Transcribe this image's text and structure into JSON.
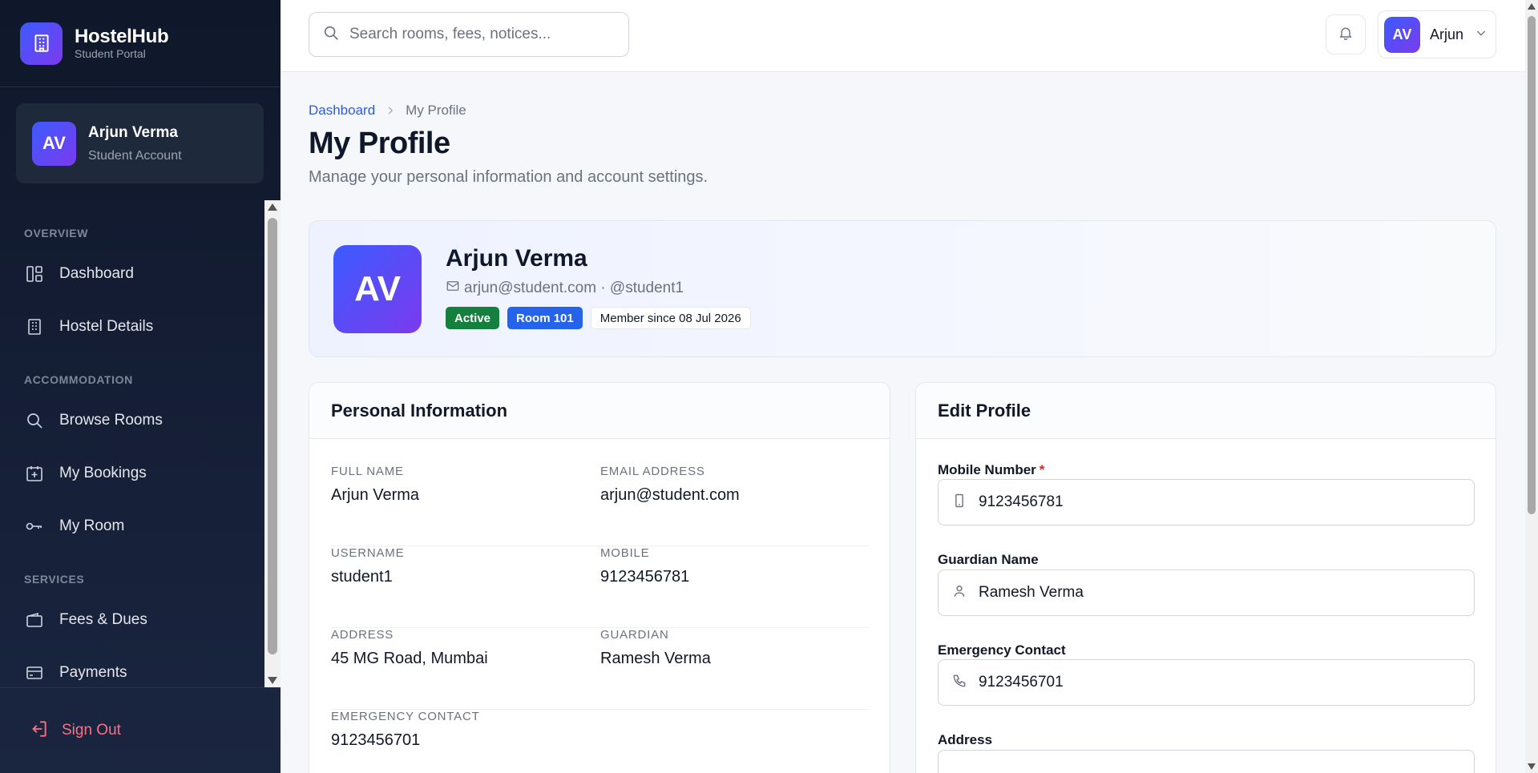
{
  "brand": {
    "title": "HostelHub",
    "subtitle": "Student Portal"
  },
  "user_card": {
    "initials": "AV",
    "name": "Arjun Verma",
    "role": "Student Account"
  },
  "nav": {
    "sections": [
      "OVERVIEW",
      "ACCOMMODATION",
      "SERVICES"
    ],
    "items": [
      {
        "label": "Dashboard",
        "icon": "dashboard-icon"
      },
      {
        "label": "Hostel Details",
        "icon": "building-icon"
      },
      {
        "label": "Browse Rooms",
        "icon": "search-icon"
      },
      {
        "label": "My Bookings",
        "icon": "calendar-plus-icon"
      },
      {
        "label": "My Room",
        "icon": "key-icon"
      },
      {
        "label": "Fees & Dues",
        "icon": "wallet-icon"
      },
      {
        "label": "Payments",
        "icon": "credit-card-icon"
      }
    ],
    "signout": "Sign Out"
  },
  "topbar": {
    "search_placeholder": "Search rooms, fees, notices...",
    "user_initials": "AV",
    "user_name": "Arjun"
  },
  "breadcrumb": {
    "home": "Dashboard",
    "current": "My Profile"
  },
  "page": {
    "title": "My Profile",
    "subtitle": "Manage your personal information and account settings."
  },
  "hero": {
    "initials": "AV",
    "name": "Arjun Verma",
    "email_line": "arjun@student.com · @student1",
    "badges": {
      "status": "Active",
      "room": "Room 101",
      "since": "Member since 08 Jul 2026"
    }
  },
  "personal_info": {
    "title": "Personal Information",
    "full_name": {
      "label": "FULL NAME",
      "value": "Arjun Verma"
    },
    "email": {
      "label": "EMAIL ADDRESS",
      "value": "arjun@student.com"
    },
    "username": {
      "label": "USERNAME",
      "value": "student1"
    },
    "mobile": {
      "label": "MOBILE",
      "value": "9123456781"
    },
    "address": {
      "label": "ADDRESS",
      "value": "45 MG Road, Mumbai"
    },
    "guardian": {
      "label": "GUARDIAN",
      "value": "Ramesh Verma"
    },
    "emergency": {
      "label": "EMERGENCY CONTACT",
      "value": "9123456701"
    }
  },
  "edit_profile": {
    "title": "Edit Profile",
    "mobile": {
      "label": "Mobile Number",
      "required": "*",
      "value": "9123456781"
    },
    "guardian": {
      "label": "Guardian Name",
      "value": "Ramesh Verma"
    },
    "emergency": {
      "label": "Emergency Contact",
      "value": "9123456701"
    },
    "address": {
      "label": "Address"
    }
  },
  "colors": {
    "accent_start": "#3b5bff",
    "accent_end": "#7c3aed",
    "sidebar": "#0f172a",
    "active_badge": "#15803d",
    "room_badge": "#2563eb",
    "signout": "#fb7185"
  }
}
